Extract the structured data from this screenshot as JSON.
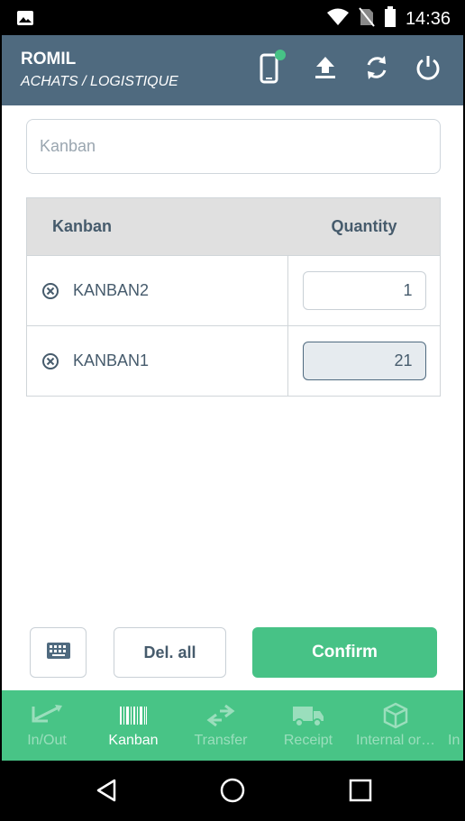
{
  "status_bar": {
    "time": "14:36",
    "icons": [
      "image-icon",
      "wifi-icon",
      "no-sim-icon",
      "battery-icon"
    ]
  },
  "header": {
    "user": "ROMIL",
    "department": "ACHATS / LOGISTIQUE",
    "actions": [
      "device-status-icon",
      "upload-icon",
      "sync-icon",
      "power-icon"
    ],
    "status_dot_color": "#47c286"
  },
  "search": {
    "placeholder": "Kanban",
    "value": ""
  },
  "table": {
    "headers": [
      "Kanban",
      "Quantity"
    ],
    "rows": [
      {
        "name": "KANBAN2",
        "quantity": "1"
      },
      {
        "name": "KANBAN1",
        "quantity": "21"
      }
    ]
  },
  "actions": {
    "keyboard_icon": "keyboard-icon",
    "delete_all": "Del. all",
    "confirm": "Confirm"
  },
  "bottom_nav": {
    "items": [
      {
        "label": "In/Out",
        "icon": "in-out-icon"
      },
      {
        "label": "Kanban",
        "icon": "barcode-icon",
        "active": true
      },
      {
        "label": "Transfer",
        "icon": "transfer-icon"
      },
      {
        "label": "Receipt",
        "icon": "truck-icon"
      },
      {
        "label": "Internal or…",
        "icon": "box-icon"
      },
      {
        "label": "In",
        "icon": "more-icon"
      }
    ]
  },
  "colors": {
    "header": "#4f6a7f",
    "accent": "#47c286",
    "text": "#465b6c"
  }
}
